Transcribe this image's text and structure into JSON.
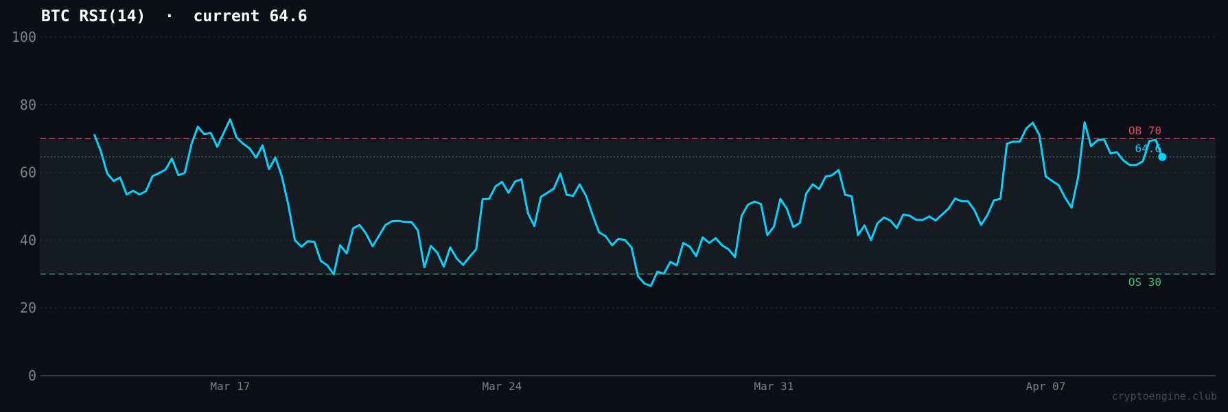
{
  "title": "BTC RSI(14)  ·  current 64.6",
  "watermark": "cryptoengine.club",
  "colors": {
    "background": "#0c0f16",
    "band": "#161a21",
    "line": "#00d4ff",
    "overbought": "#c2404f",
    "overbought_label": "#e0475e",
    "oversold": "#2f8a5a",
    "oversold_label": "#3fbf75",
    "current_level": "#8a8f98",
    "grid": "#2a2e35"
  },
  "chart_data": {
    "type": "line",
    "title": "BTC RSI(14)  ·  current 64.6",
    "xlabel": "",
    "ylabel": "",
    "ylim": [
      0,
      100
    ],
    "yticks": [
      "0",
      "20",
      "40",
      "60",
      "80",
      "100"
    ],
    "xticks": [
      {
        "label": "Mar 17",
        "x": "Mar 17 00:00"
      },
      {
        "label": "Mar 24",
        "x": "Mar 24 00:00"
      },
      {
        "label": "Mar 31",
        "x": "Mar 31 00:00"
      },
      {
        "label": "Apr 07",
        "x": "Apr 07 00:00"
      }
    ],
    "grid": "horizontal dotted",
    "reference_lines": [
      {
        "label": "OB 70",
        "value": 70,
        "style": "dashed",
        "color": "#c2404f"
      },
      {
        "label": "OS 30",
        "value": 30,
        "style": "dashed",
        "color": "#2f8a5a"
      },
      {
        "label": "64.6",
        "value": 64.6,
        "style": "dotted",
        "color": "#8a8f98"
      }
    ],
    "band": [
      30,
      70
    ],
    "current": {
      "label": "64.6",
      "value": 64.6
    },
    "x": [
      "Mar 13 12:00",
      "Mar 13 16:00",
      "Mar 13 20:00",
      "Mar 14 00:00",
      "Mar 14 04:00",
      "Mar 14 08:00",
      "Mar 14 12:00",
      "Mar 14 16:00",
      "Mar 14 20:00",
      "Mar 15 00:00",
      "Mar 15 04:00",
      "Mar 15 08:00",
      "Mar 15 12:00",
      "Mar 15 16:00",
      "Mar 15 20:00",
      "Mar 16 00:00",
      "Mar 16 04:00",
      "Mar 16 08:00",
      "Mar 16 12:00",
      "Mar 16 16:00",
      "Mar 16 20:00",
      "Mar 17 00:00",
      "Mar 17 04:00",
      "Mar 17 08:00",
      "Mar 17 12:00",
      "Mar 17 16:00",
      "Mar 17 20:00",
      "Mar 18 00:00",
      "Mar 18 04:00",
      "Mar 18 08:00",
      "Mar 18 12:00",
      "Mar 18 16:00",
      "Mar 18 20:00",
      "Mar 19 00:00",
      "Mar 19 04:00",
      "Mar 19 08:00",
      "Mar 19 12:00",
      "Mar 19 16:00",
      "Mar 19 20:00",
      "Mar 20 00:00",
      "Mar 20 04:00",
      "Mar 20 08:00",
      "Mar 20 12:00",
      "Mar 20 16:00",
      "Mar 20 20:00",
      "Mar 21 00:00",
      "Mar 21 04:00",
      "Mar 21 08:00",
      "Mar 21 12:00",
      "Mar 21 16:00",
      "Mar 21 20:00",
      "Mar 22 00:00",
      "Mar 22 04:00",
      "Mar 22 08:00",
      "Mar 22 12:00",
      "Mar 22 16:00",
      "Mar 22 20:00",
      "Mar 23 00:00",
      "Mar 23 04:00",
      "Mar 23 08:00",
      "Mar 23 12:00",
      "Mar 23 16:00",
      "Mar 23 20:00",
      "Mar 24 00:00",
      "Mar 24 04:00",
      "Mar 24 08:00",
      "Mar 24 12:00",
      "Mar 24 16:00",
      "Mar 24 20:00",
      "Mar 25 00:00",
      "Mar 25 04:00",
      "Mar 25 08:00",
      "Mar 25 12:00",
      "Mar 25 16:00",
      "Mar 25 20:00",
      "Mar 26 00:00",
      "Mar 26 04:00",
      "Mar 26 08:00",
      "Mar 26 12:00",
      "Mar 26 16:00",
      "Mar 26 20:00",
      "Mar 27 00:00",
      "Mar 27 04:00",
      "Mar 27 08:00",
      "Mar 27 12:00",
      "Mar 27 16:00",
      "Mar 27 20:00",
      "Mar 28 00:00",
      "Mar 28 04:00",
      "Mar 28 08:00",
      "Mar 28 12:00",
      "Mar 28 16:00",
      "Mar 28 20:00",
      "Mar 29 00:00",
      "Mar 29 04:00",
      "Mar 29 08:00",
      "Mar 29 12:00",
      "Mar 29 16:00",
      "Mar 29 20:00",
      "Mar 30 00:00",
      "Mar 30 04:00",
      "Mar 30 08:00",
      "Mar 30 12:00",
      "Mar 30 16:00",
      "Mar 30 20:00",
      "Mar 31 00:00",
      "Mar 31 04:00",
      "Mar 31 08:00",
      "Mar 31 12:00",
      "Mar 31 16:00",
      "Mar 31 20:00",
      "Apr 01 00:00",
      "Apr 01 04:00",
      "Apr 01 08:00",
      "Apr 01 12:00",
      "Apr 01 16:00",
      "Apr 01 20:00",
      "Apr 02 00:00",
      "Apr 02 04:00",
      "Apr 02 08:00",
      "Apr 02 12:00",
      "Apr 02 16:00",
      "Apr 02 20:00",
      "Apr 03 00:00",
      "Apr 03 04:00",
      "Apr 03 08:00",
      "Apr 03 12:00",
      "Apr 03 16:00",
      "Apr 03 20:00",
      "Apr 04 00:00",
      "Apr 04 04:00",
      "Apr 04 08:00",
      "Apr 04 12:00",
      "Apr 04 16:00",
      "Apr 04 20:00",
      "Apr 05 00:00",
      "Apr 05 04:00",
      "Apr 05 08:00",
      "Apr 05 12:00",
      "Apr 05 16:00",
      "Apr 05 20:00",
      "Apr 06 00:00",
      "Apr 06 04:00",
      "Apr 06 08:00",
      "Apr 06 12:00",
      "Apr 06 16:00",
      "Apr 06 20:00",
      "Apr 07 00:00",
      "Apr 07 04:00",
      "Apr 07 08:00",
      "Apr 07 12:00",
      "Apr 07 16:00",
      "Apr 07 20:00",
      "Apr 08 00:00",
      "Apr 08 04:00",
      "Apr 08 08:00",
      "Apr 08 12:00",
      "Apr 08 16:00",
      "Apr 08 20:00",
      "Apr 09 00:00",
      "Apr 09 04:00",
      "Apr 09 08:00",
      "Apr 09 12:00",
      "Apr 09 16:00",
      "Apr 09 20:00",
      "Apr 10 00:00"
    ],
    "series": [
      {
        "values": [
          71.3,
          66.4,
          59.7,
          57.5,
          58.5,
          53.5,
          54.6,
          53.5,
          54.5,
          58.9,
          59.8,
          60.8,
          64.1,
          59.2,
          59.9,
          68.2,
          73.5,
          71.3,
          71.7,
          67.6,
          71.7,
          75.7,
          70.3,
          68.5,
          67.1,
          64.4,
          68.0,
          61.0,
          64.4,
          58.7,
          50.3,
          40.0,
          38.1,
          39.7,
          39.5,
          33.9,
          32.6,
          29.9,
          38.5,
          36.1,
          43.5,
          44.5,
          41.9,
          38.2,
          41.3,
          44.5,
          45.6,
          45.7,
          45.4,
          45.4,
          42.9,
          32.0,
          38.3,
          36.3,
          32.2,
          37.9,
          34.6,
          32.7,
          35.1,
          37.3,
          52.1,
          52.2,
          55.9,
          57.2,
          54.0,
          57.3,
          58.0,
          48.0,
          44.2,
          52.8,
          54.0,
          55.2,
          59.7,
          53.4,
          53.1,
          56.5,
          53.0,
          47.4,
          42.3,
          41.2,
          38.5,
          40.4,
          40.0,
          37.9,
          29.4,
          27.2,
          26.5,
          30.7,
          30.1,
          33.6,
          32.6,
          39.2,
          38.1,
          35.3,
          40.8,
          39.2,
          40.6,
          38.5,
          37.3,
          35.0,
          47.1,
          50.5,
          51.4,
          50.7,
          41.5,
          44.0,
          52.2,
          49.3,
          43.9,
          45.1,
          53.8,
          56.5,
          55.1,
          58.8,
          59.2,
          60.7,
          53.4,
          53.0,
          41.5,
          44.4,
          40.0,
          45.0,
          46.7,
          45.8,
          43.6,
          47.6,
          47.2,
          46.0,
          46.0,
          47.0,
          45.8,
          47.6,
          49.4,
          52.3,
          51.5,
          51.5,
          48.8,
          44.5,
          47.4,
          51.8,
          52.2,
          68.5,
          69.1,
          69.1,
          73.0,
          74.7,
          71.1,
          58.8,
          57.5,
          56.2,
          52.5,
          49.6,
          58.7,
          74.8,
          67.8,
          69.5,
          69.8,
          65.6,
          66.0,
          63.5,
          62.2,
          62.2,
          63.3,
          69.3,
          69.6,
          64.6
        ]
      }
    ]
  }
}
